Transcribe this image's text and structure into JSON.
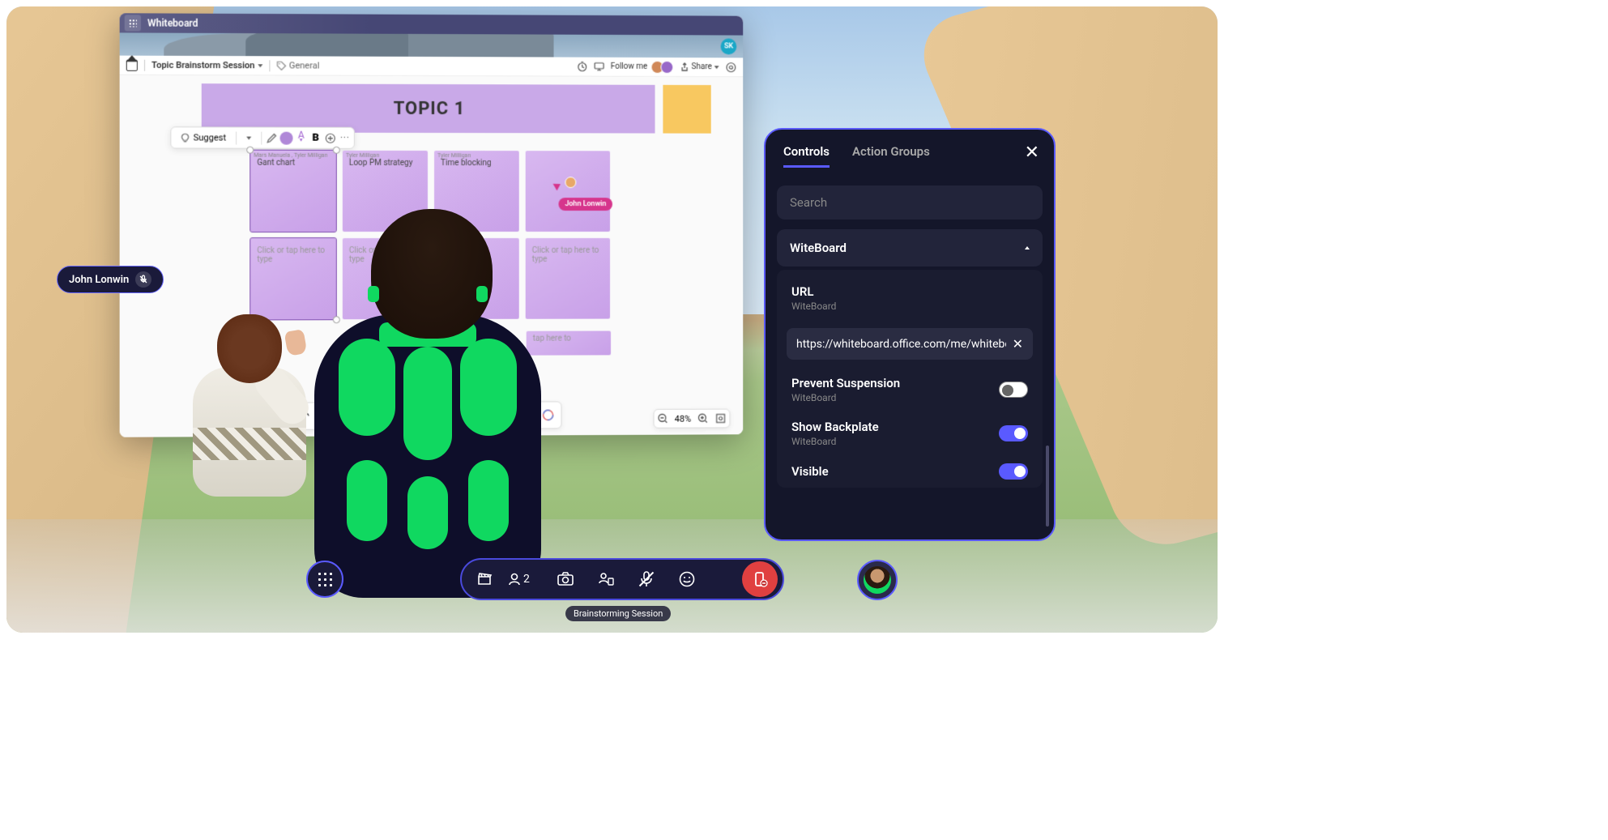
{
  "whiteboard": {
    "app_name": "Whiteboard",
    "board_name": "Topic Brainstorm Session",
    "tag": "General",
    "follow_label": "Follow me",
    "share_label": "Share",
    "user_badge": "SK",
    "topic1_title": "TOPIC 1",
    "suggest_label": "Suggest",
    "bold_label": "B",
    "letter_a": "A",
    "notes": [
      {
        "author": "Mars Manuela , Tyler Milligan",
        "text": "Gant chart"
      },
      {
        "author": "Tyler Milligan",
        "text": "Loop PM strategy"
      },
      {
        "author": "Tyler Milligan",
        "text": "Time blocking"
      },
      {
        "author": "",
        "text": ""
      },
      {
        "author": "",
        "text": "Click or tap here to type"
      },
      {
        "author": "",
        "text": "Click or tap here to type"
      },
      {
        "author": "",
        "text": ""
      },
      {
        "author": "",
        "text": "Click or tap here to type"
      }
    ],
    "placeholder_text": "tap here to",
    "cursor_user": "John Lonwin",
    "zoom": "48%"
  },
  "user_label": {
    "name": "John Lonwin"
  },
  "panel": {
    "tabs": {
      "controls": "Controls",
      "action_groups": "Action Groups"
    },
    "search_placeholder": "Search",
    "section_name": "WiteBoard",
    "url": {
      "label": "URL",
      "sub": "WiteBoard",
      "value": "https://whiteboard.office.com/me/whiteboa"
    },
    "prevent": {
      "label": "Prevent Suspension",
      "sub": "WiteBoard"
    },
    "backplate": {
      "label": "Show Backplate",
      "sub": "WiteBoard"
    },
    "visible": {
      "label": "Visible"
    }
  },
  "hud": {
    "participants": "2",
    "tooltip": "Brainstorming Session"
  }
}
